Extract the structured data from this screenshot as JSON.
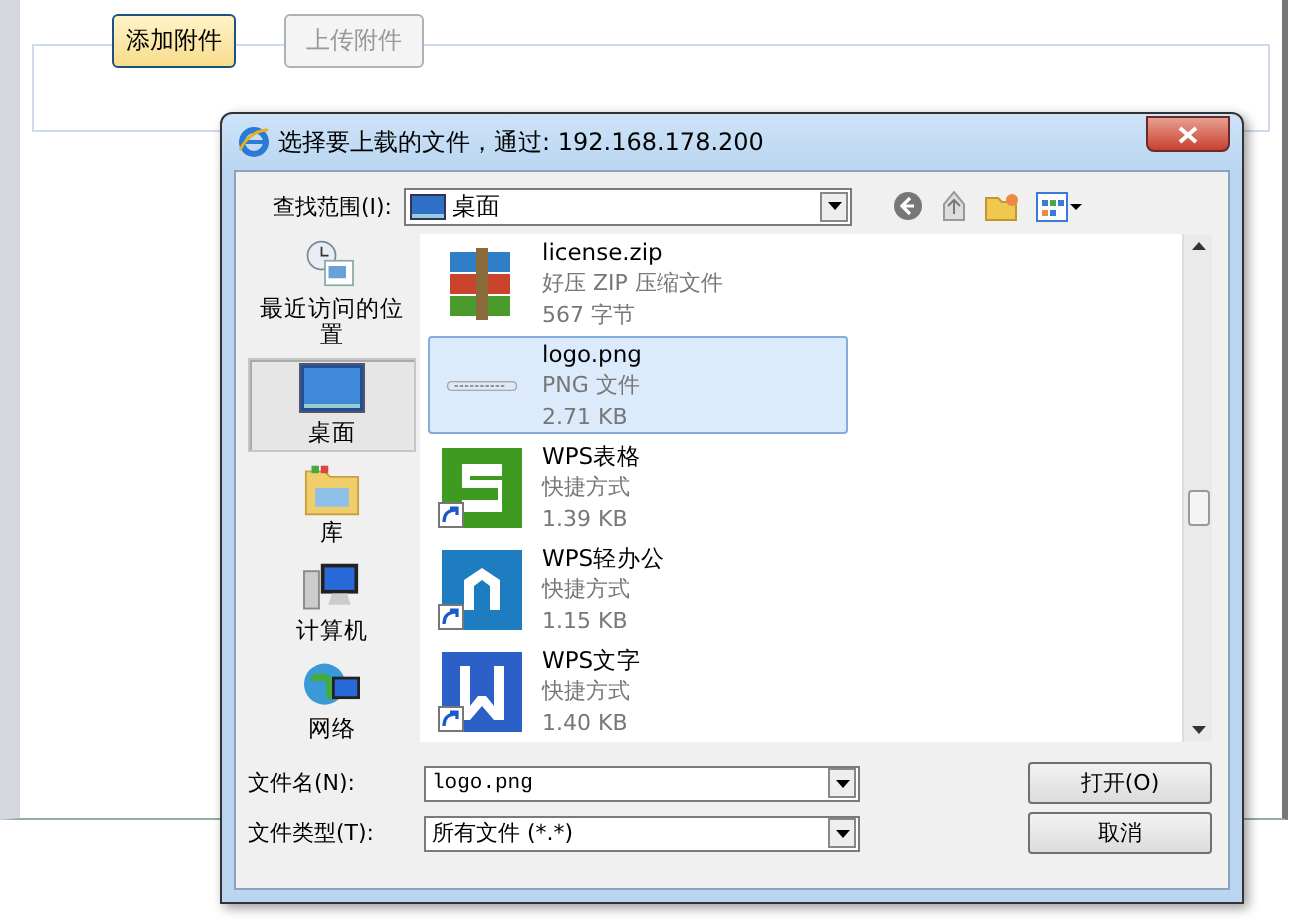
{
  "page": {
    "add_button": "添加附件",
    "upload_button": {
      "label": "上传附件",
      "disabled": true
    }
  },
  "dialog": {
    "title": "选择要上载的文件，通过: 192.168.178.200",
    "look_in": {
      "label": "查找范围(I):",
      "value": "桌面"
    },
    "places": [
      {
        "label": "最近访问的位置",
        "kind": "recent",
        "selected": false
      },
      {
        "label": "桌面",
        "kind": "desktop",
        "selected": true
      },
      {
        "label": "库",
        "kind": "library",
        "selected": false
      },
      {
        "label": "计算机",
        "kind": "computer",
        "selected": false
      },
      {
        "label": "网络",
        "kind": "network",
        "selected": false
      }
    ],
    "files": [
      {
        "name": "license.zip",
        "type": "好压 ZIP 压缩文件",
        "size": "567 字节",
        "kind": "archive",
        "shortcut": false,
        "selected": false
      },
      {
        "name": "logo.png",
        "type": "PNG 文件",
        "size": "2.71 KB",
        "kind": "image",
        "shortcut": false,
        "selected": true
      },
      {
        "name": "WPS表格",
        "type": "快捷方式",
        "size": "1.39 KB",
        "kind": "spreadsheet",
        "shortcut": true,
        "selected": false
      },
      {
        "name": "WPS轻办公",
        "type": "快捷方式",
        "size": "1.15 KB",
        "kind": "office",
        "shortcut": true,
        "selected": false
      },
      {
        "name": "WPS文字",
        "type": "快捷方式",
        "size": "1.40 KB",
        "kind": "writer",
        "shortcut": true,
        "selected": false
      }
    ],
    "file_name": {
      "label": "文件名(N):",
      "value": "logo.png"
    },
    "file_type": {
      "label": "文件类型(T):",
      "value": "所有文件 (*.*)"
    },
    "buttons": [
      "打开(O)",
      "取消"
    ]
  }
}
